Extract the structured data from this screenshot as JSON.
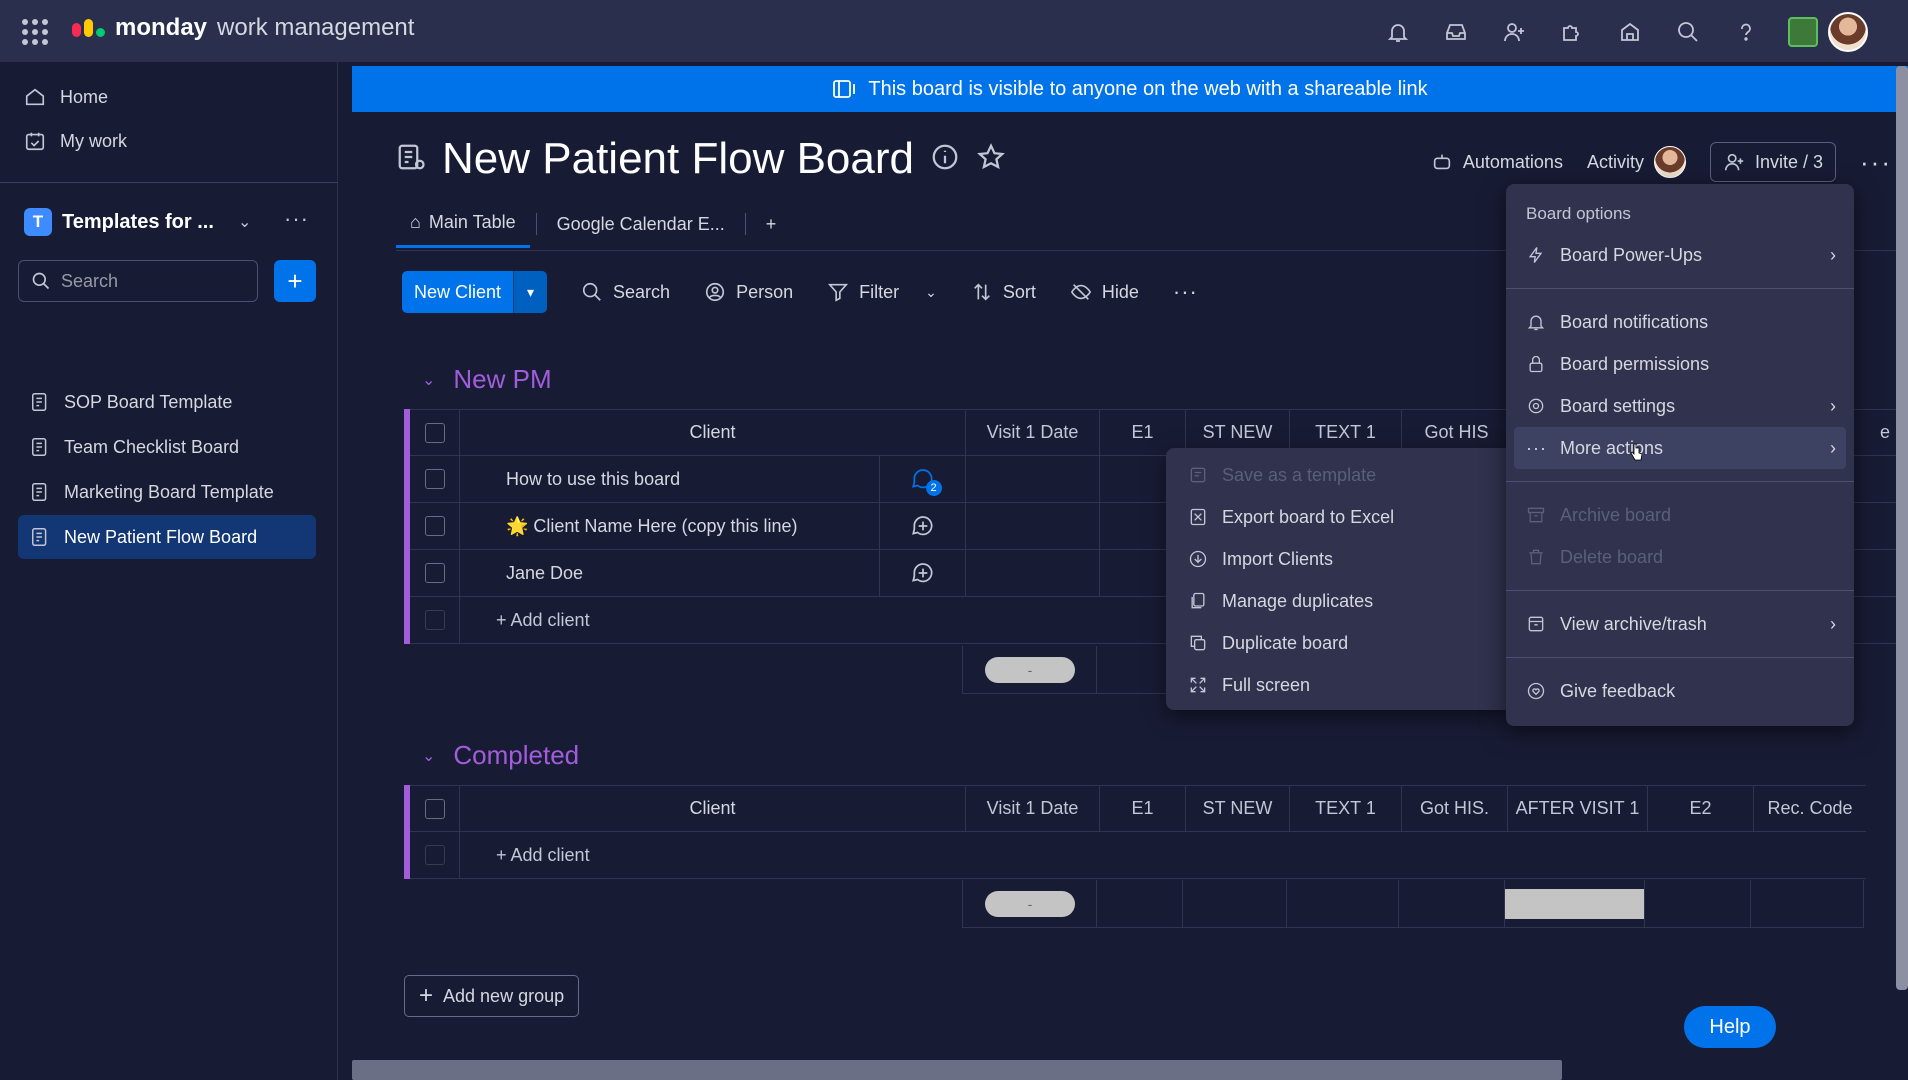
{
  "app": {
    "brand": "monday",
    "product": "work management"
  },
  "sidebar": {
    "home": "Home",
    "my_work": "My work",
    "workspace": {
      "badge": "T",
      "name": "Templates for ..."
    },
    "search_placeholder": "Search",
    "boards": [
      {
        "label": "SOP Board Template"
      },
      {
        "label": "Team Checklist Board"
      },
      {
        "label": "Marketing Board Template"
      },
      {
        "label": "New Patient Flow Board"
      }
    ]
  },
  "banner": "This board is visible to anyone on the web with a shareable link",
  "board": {
    "title": "New Patient Flow Board",
    "automations": "Automations",
    "activity": "Activity",
    "invite": "Invite / 3",
    "tabs": [
      "Main Table",
      "Google Calendar E...",
      "+"
    ]
  },
  "toolbar": {
    "new_item": "New Client",
    "search": "Search",
    "person": "Person",
    "filter": "Filter",
    "sort": "Sort",
    "hide": "Hide"
  },
  "groups": [
    {
      "title": "New PM",
      "columns": [
        "Client",
        "Visit 1 Date",
        "E1",
        "ST NEW",
        "TEXT 1",
        "Got HIS",
        "e"
      ],
      "rows": [
        {
          "name": "How to use this board",
          "updates": "2"
        },
        {
          "name": "🌟 Client Name Here (copy this line)"
        },
        {
          "name": "Jane Doe"
        }
      ],
      "add_label": "+ Add client",
      "summary_pill": "-"
    },
    {
      "title": "Completed",
      "columns": [
        "Client",
        "Visit 1 Date",
        "E1",
        "ST NEW",
        "TEXT 1",
        "Got HIS.",
        "AFTER VISIT 1",
        "E2",
        "Rec. Code"
      ],
      "add_label": "+ Add client",
      "summary_pill": "-"
    }
  ],
  "add_group": "Add new group",
  "help": "Help",
  "board_menu": {
    "header": "Board options",
    "items": {
      "power_ups": "Board Power-Ups",
      "notifications": "Board notifications",
      "permissions": "Board permissions",
      "settings": "Board settings",
      "more_actions": "More actions",
      "archive": "Archive board",
      "delete": "Delete board",
      "view_archive": "View archive/trash",
      "feedback": "Give feedback"
    }
  },
  "more_actions_menu": {
    "save_template": "Save as a template",
    "export_excel": "Export board to Excel",
    "import_clients": "Import Clients",
    "manage_duplicates": "Manage duplicates",
    "duplicate_board": "Duplicate board",
    "full_screen": "Full screen"
  },
  "colors": {
    "accent": "#0073ea",
    "group": "#a25ddc",
    "topbar": "#292f4c",
    "background": "#181b34"
  }
}
